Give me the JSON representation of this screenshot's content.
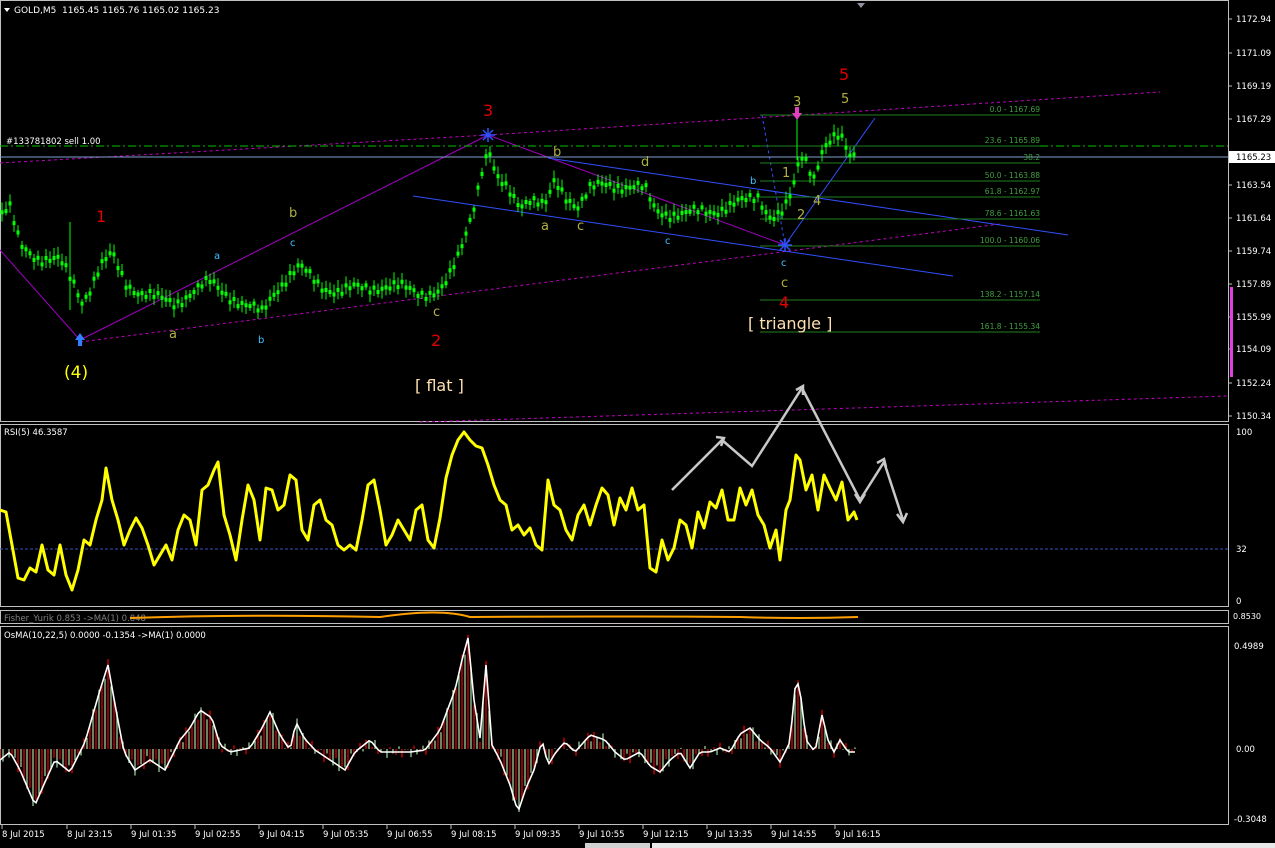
{
  "header": {
    "symbol": "GOLD,M5",
    "ohlc": "1165.45 1165.76 1165.02 1165.23"
  },
  "main_chart": {
    "price_labels": [
      "1172.94",
      "1171.09",
      "1169.19",
      "1167.29",
      "1165.23",
      "1163.54",
      "1161.64",
      "1159.74",
      "1157.89",
      "1155.99",
      "1154.09",
      "1152.24",
      "1150.34"
    ],
    "current_price": "1165.23",
    "order_label": "#133781802 sell 1.00",
    "fib_levels": [
      "0.0 - 1167.69",
      "23.6 - 1165.89",
      "38.2",
      "50.0 - 1163.88",
      "61.8 - 1162.97",
      "78.6 - 1161.63",
      "100.0 - 1160.06",
      "138.2 - 1157.14",
      "161.8 - 1155.34"
    ],
    "wave_labels": {
      "w4_big": "(4)",
      "w1_red": "1",
      "w2_red": "2",
      "w3_red": "3",
      "w4_red": "4",
      "w5_red": "5",
      "flat": "[ flat ]",
      "triangle": "[ triangle ]",
      "a1": "a",
      "b1": "b",
      "c1": "c",
      "a2": "a",
      "b2": "b",
      "c2": "c",
      "a3": "a",
      "b3": "b",
      "c3": "c",
      "d3": "d",
      "c4": "c",
      "b4": "b",
      "c_flat": "c",
      "sub1": "1",
      "sub2": "2",
      "sub3": "3",
      "sub4": "4",
      "sub5": "5"
    }
  },
  "rsi_panel": {
    "label": "RSI(5) 46.3587",
    "levels": [
      "100",
      "32",
      "0"
    ]
  },
  "fisher_panel": {
    "label": "Fisher_Yurik 0.853  ->MA(1) 0.848",
    "right_value": "0.8530"
  },
  "osma_panel": {
    "label": "OsMA(10,22,5) 0.0000 -0.1354  ->MA(1) 0.0000",
    "levels": [
      "0.4989",
      "0.00",
      "-0.3048"
    ]
  },
  "time_axis": [
    "8 Jul 2015",
    "8 Jul 23:15",
    "9 Jul 01:35",
    "9 Jul 02:55",
    "9 Jul 04:15",
    "9 Jul 05:35",
    "9 Jul 06:55",
    "9 Jul 08:15",
    "9 Jul 09:35",
    "9 Jul 10:55",
    "9 Jul 12:15",
    "9 Jul 13:35",
    "9 Jul 14:55",
    "9 Jul 16:15"
  ],
  "colors": {
    "background": "#000000",
    "candle": "#00ff00",
    "rsi_line": "#ffff00",
    "wave_red": "#ff0000",
    "wave_yellow": "#ffff00",
    "wave_olive": "#b0b040",
    "wave_cyan": "#40c0ff",
    "channel_magenta": "#c000c0",
    "channel_blue": "#4060ff",
    "fib_green": "#208020",
    "order_green": "#00c000"
  }
}
